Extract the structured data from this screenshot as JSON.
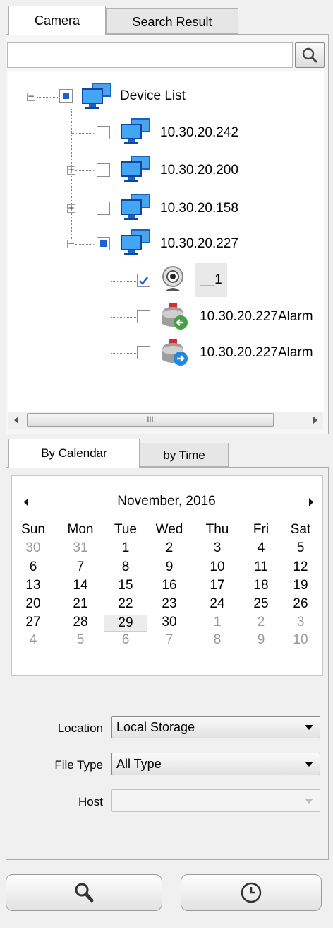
{
  "top_tabs": [
    {
      "label": "Camera"
    },
    {
      "label": "Search Result"
    }
  ],
  "search": {
    "value": ""
  },
  "tree": {
    "root": {
      "label": "Device List"
    },
    "devices": [
      {
        "label": "10.30.20.242"
      },
      {
        "label": "10.30.20.200"
      },
      {
        "label": "10.30.20.158"
      },
      {
        "label": "10.30.20.227"
      }
    ],
    "children": [
      {
        "label": "__1"
      },
      {
        "label": "10.30.20.227Alarm"
      },
      {
        "label": "10.30.20.227Alarm"
      }
    ],
    "scroll_grip": "III"
  },
  "date_tabs": [
    {
      "label": "By Calendar"
    },
    {
      "label": "by Time"
    }
  ],
  "calendar": {
    "month": "November, 2016",
    "dow": [
      "Sun",
      "Mon",
      "Tue",
      "Wed",
      "Thu",
      "Fri",
      "Sat"
    ],
    "weeks": [
      [
        "30",
        "31",
        "1",
        "2",
        "3",
        "4",
        "5"
      ],
      [
        "6",
        "7",
        "8",
        "9",
        "10",
        "11",
        "12"
      ],
      [
        "13",
        "14",
        "15",
        "16",
        "17",
        "18",
        "19"
      ],
      [
        "20",
        "21",
        "22",
        "23",
        "24",
        "25",
        "26"
      ],
      [
        "27",
        "28",
        "29",
        "30",
        "1",
        "2",
        "3"
      ],
      [
        "4",
        "5",
        "6",
        "7",
        "8",
        "9",
        "10"
      ]
    ]
  },
  "filters": {
    "location_label": "Location",
    "location_value": "Local Storage",
    "filetype_label": "File Type",
    "filetype_value": "All Type",
    "host_label": "Host",
    "host_value": ""
  }
}
